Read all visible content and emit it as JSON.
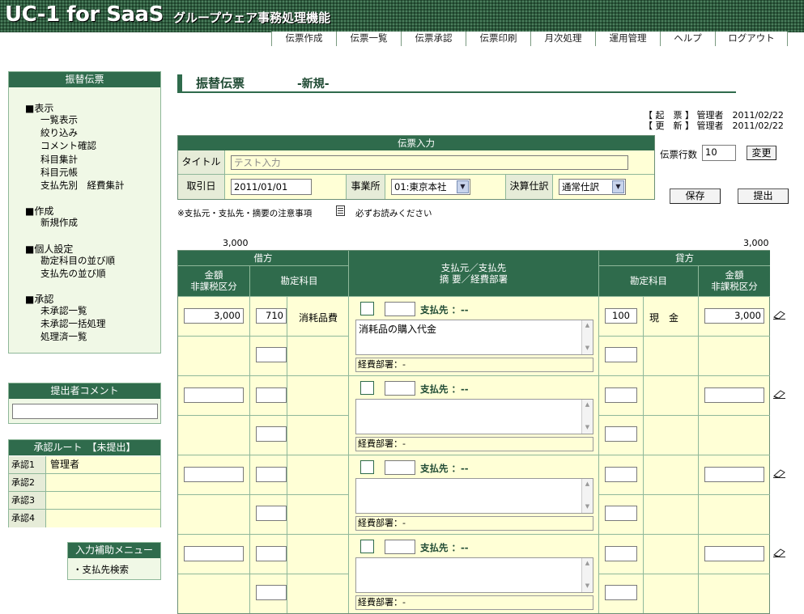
{
  "app": {
    "logo": "UC-1 for SaaS",
    "subtitle": "グループウェア事務処理機能"
  },
  "menu": [
    "伝票作成",
    "伝票一覧",
    "伝票承認",
    "伝票印刷",
    "月次処理",
    "運用管理",
    "ヘルプ",
    "ログアウト"
  ],
  "sidebar": {
    "title": "振替伝票",
    "sections": [
      {
        "head": "■表示",
        "items": [
          "一覧表示",
          "絞り込み",
          "コメント確認",
          "科目集計",
          "科目元帳",
          "支払先別　経費集計"
        ]
      },
      {
        "head": "■作成",
        "items": [
          "新規作成"
        ]
      },
      {
        "head": "■個人設定",
        "items": [
          "勘定科目の並び順",
          "支払先の並び順"
        ]
      },
      {
        "head": "■承認",
        "items": [
          "未承認一覧",
          "未承認一括処理",
          "処理済一覧"
        ]
      }
    ]
  },
  "comment_panel": {
    "title": "提出者コメント",
    "value": ""
  },
  "route": {
    "title": "承認ルート　【未提出】",
    "rows": [
      {
        "label": "承認1",
        "value": "管理者"
      },
      {
        "label": "承認2",
        "value": ""
      },
      {
        "label": "承認3",
        "value": ""
      },
      {
        "label": "承認4",
        "value": ""
      }
    ]
  },
  "assist": {
    "title": "入力補助メニュー",
    "items": [
      "・支払先検索"
    ]
  },
  "page": {
    "title": "振替伝票",
    "mode": "-新規-",
    "created": "【 起　票 】 管理者　2011/02/22",
    "updated": "【 更　新 】 管理者　2011/02/22"
  },
  "form": {
    "header": "伝票入力",
    "title_label": "タイトル",
    "title_value": "テスト入力",
    "date_label": "取引日",
    "date_value": "2011/01/01",
    "office_label": "事業所",
    "office_value": "01:東京本社",
    "settle_label": "決算仕訳",
    "settle_value": "通常仕訳",
    "rows_label": "伝票行数",
    "rows_value": "10",
    "change_btn": "変更",
    "save_btn": "保存",
    "submit_btn": "提出",
    "note": "※支払元・支払先・摘要の注意事項",
    "note2": "必ずお読みください"
  },
  "entries": {
    "debit_total": "3,000",
    "credit_total": "3,000",
    "head": {
      "debit": "借方",
      "credit": "貸方",
      "amount": "金額",
      "taxcls": "非課税区分",
      "account": "勘定科目",
      "mid1": "支払元／支払先",
      "mid2": "摘 要／経費部署"
    },
    "payee_label": "支払先 ：--",
    "dept_label": "経費部署：-",
    "rows": [
      {
        "debit_amount": "3,000",
        "debit_code": "710",
        "debit_name": "消耗品費",
        "memo": "消耗品の購入代金",
        "credit_code": "100",
        "credit_name": "現　金",
        "credit_amount": "3,000"
      },
      {
        "debit_amount": "",
        "debit_code": "",
        "debit_name": "",
        "memo": "",
        "credit_code": "",
        "credit_name": "",
        "credit_amount": ""
      },
      {
        "debit_amount": "",
        "debit_code": "",
        "debit_name": "",
        "memo": "",
        "credit_code": "",
        "credit_name": "",
        "credit_amount": ""
      },
      {
        "debit_amount": "",
        "debit_code": "",
        "debit_name": "",
        "memo": "",
        "credit_code": "",
        "credit_name": "",
        "credit_amount": ""
      }
    ]
  }
}
